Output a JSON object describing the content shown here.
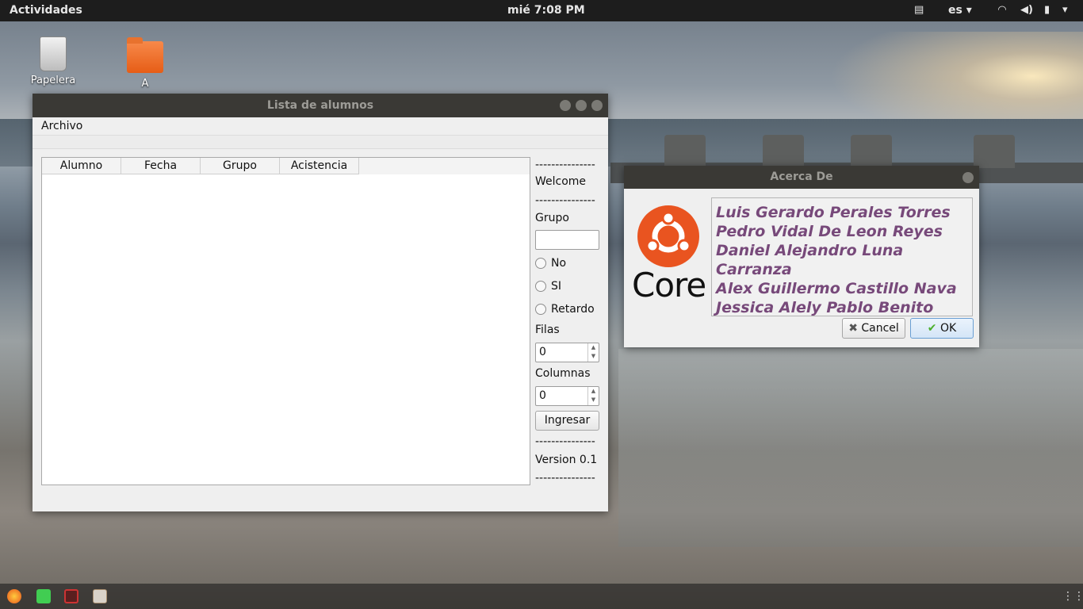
{
  "topbar": {
    "activities": "Actividades",
    "clock": "mié   7:08 PM",
    "language": "es ▾",
    "icons": [
      "screen-icon",
      "wifi-icon",
      "volume-icon",
      "battery-icon",
      "power-menu-icon"
    ]
  },
  "desktop": {
    "icons": [
      {
        "label": "Papelera",
        "icon": "trash-icon"
      },
      {
        "label": "A",
        "icon": "folder-icon"
      }
    ]
  },
  "main_window": {
    "title": "Lista de alumnos",
    "menu": [
      "Archivo"
    ],
    "table": {
      "columns": [
        "Alumno",
        "Fecha",
        "Grupo",
        "Acistencia"
      ],
      "rows": []
    },
    "side_panel": {
      "separator": "---------------",
      "welcome": "Welcome",
      "grupo_label": "Grupo",
      "grupo_value": "",
      "radios": [
        "No",
        "SI",
        "Retardo"
      ],
      "filas_label": "Filas",
      "filas_value": "0",
      "columnas_label": "Columnas",
      "columnas_value": "0",
      "ingresar_label": "Ingresar",
      "version": "Version 0.1"
    }
  },
  "about_dialog": {
    "title": "Acerca De",
    "logo_text": "Core",
    "credits": [
      "Luis Gerardo Perales Torres",
      "Pedro Vidal De Leon Reyes",
      "Daniel Alejandro Luna Carranza",
      "Alex Guillermo Castillo Nava",
      "Jessica Alely Pablo Benito"
    ],
    "cancel_label": "Cancel",
    "ok_label": "OK"
  },
  "dock": {
    "icons": [
      "firefox-icon",
      "qt-creator-icon",
      "terminal-icon",
      "app-icon"
    ],
    "apps_grid_icon": "apps-grid-icon"
  }
}
